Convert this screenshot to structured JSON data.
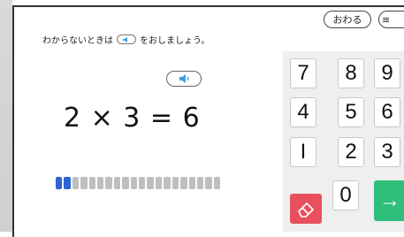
{
  "header": {
    "instruction_before": "わからないときは",
    "instruction_after": "をおしましょう。",
    "quit_label": "おわる",
    "menu_label": "≡"
  },
  "question": {
    "equation": "2 × 3 = 6"
  },
  "progress": {
    "completed": 2,
    "total": 20
  },
  "keypad": {
    "keys": [
      "7",
      "8",
      "9",
      "4",
      "5",
      "6",
      "I",
      "2",
      "3",
      "0"
    ],
    "enter_label": "→"
  },
  "icons": {
    "speaker": "speaker-icon",
    "eraser": "eraser-icon",
    "menu": "menu-icon"
  },
  "colors": {
    "progress_done": "#2e63d1",
    "progress_todo": "#bfbfbf",
    "erase_key": "#e8505d",
    "enter_key": "#2fbf7a"
  }
}
